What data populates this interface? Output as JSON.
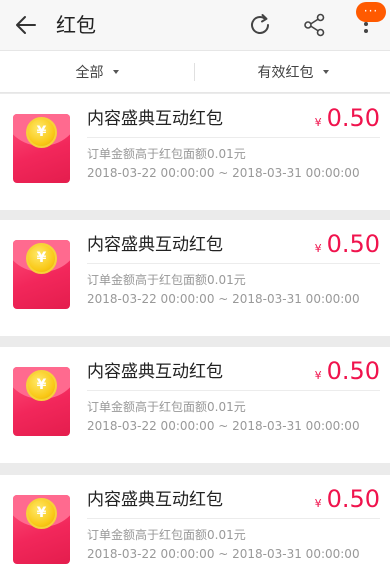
{
  "header": {
    "title": "红包",
    "badge_text": "···"
  },
  "filters": [
    {
      "label": "全部"
    },
    {
      "label": "有效红包"
    }
  ],
  "coupons": [
    {
      "coin": "¥",
      "title": "内容盛典互动红包",
      "currency": "¥",
      "amount": "0.50",
      "condition": "订单金额高于红包面额0.01元",
      "period": "2018-03-22 00:00:00 ~ 2018-03-31 00:00:00"
    },
    {
      "coin": "¥",
      "title": "内容盛典互动红包",
      "currency": "¥",
      "amount": "0.50",
      "condition": "订单金额高于红包面额0.01元",
      "period": "2018-03-22 00:00:00 ~ 2018-03-31 00:00:00"
    },
    {
      "coin": "¥",
      "title": "内容盛典互动红包",
      "currency": "¥",
      "amount": "0.50",
      "condition": "订单金额高于红包面额0.01元",
      "period": "2018-03-22 00:00:00 ~ 2018-03-31 00:00:00"
    },
    {
      "coin": "¥",
      "title": "内容盛典互动红包",
      "currency": "¥",
      "amount": "0.50",
      "condition": "订单金额高于红包面额0.01元",
      "period": "2018-03-22 00:00:00 ~ 2018-03-31 00:00:00"
    }
  ],
  "colors": {
    "accent_amount": "#f0134d",
    "badge": "#ff5a00",
    "envelope": "#f2275b",
    "coin": "#f9c816"
  },
  "icons": {
    "back": "arrow-left-icon",
    "refresh": "refresh-icon",
    "share": "share-icon",
    "more": "more-vertical-icon"
  }
}
